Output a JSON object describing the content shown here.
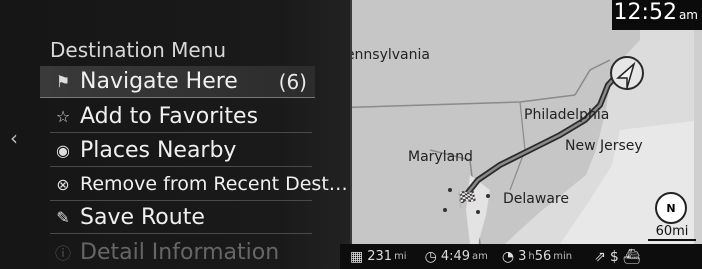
{
  "clock": {
    "time": "12:52",
    "ampm": "am"
  },
  "menu": {
    "title": "Destination Menu",
    "items": [
      {
        "label": "Navigate Here",
        "count": "(6)",
        "icon": "checkered-flag-icon"
      },
      {
        "label": "Add to Favorites",
        "icon": "star-add-icon"
      },
      {
        "label": "Places Nearby",
        "icon": "places-icon"
      },
      {
        "label": "Remove from Recent Dest…",
        "icon": "remove-recent-icon"
      },
      {
        "label": "Save Route",
        "icon": "save-route-icon"
      },
      {
        "label": "Detail Information",
        "icon": "info-icon"
      }
    ]
  },
  "map": {
    "labels": {
      "pennsylvania": "Pennsylvania",
      "philadelphia": "Philadelphia",
      "maryland": "Maryland",
      "new_jersey": "New Jersey",
      "delaware": "Delaware"
    },
    "compass": "N",
    "scale": "60mi"
  },
  "status": {
    "distance": "231",
    "distance_unit": "mi",
    "arrival_time": "4:49",
    "arrival_ampm": "am",
    "duration_h": "3",
    "duration_h_unit": "h",
    "duration_m": "56",
    "duration_m_unit": "min"
  }
}
